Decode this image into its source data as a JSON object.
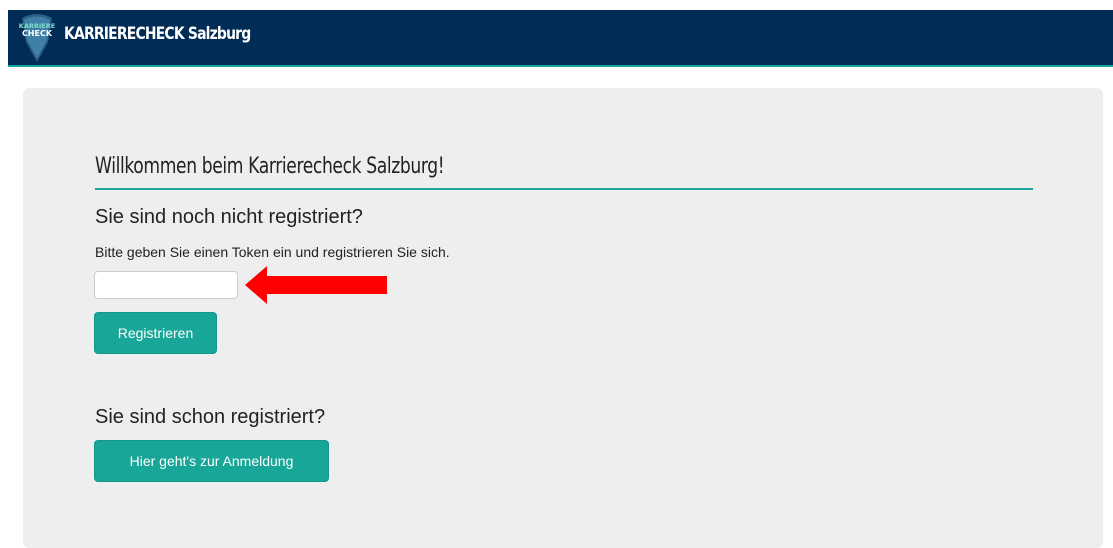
{
  "header": {
    "brand": "KARRIERECHECK Salzburg",
    "logo_text_line1": "KARRIERE",
    "logo_text_line2": "CHECK"
  },
  "main": {
    "welcome_title": "Willkommen beim Karrierecheck Salzburg!",
    "register_heading": "Sie sind noch nicht registriert?",
    "register_hint": "Bitte geben Sie einen Token ein und registrieren Sie sich.",
    "token_input_value": "",
    "register_button": "Registrieren",
    "login_heading": "Sie sind schon registriert?",
    "login_button": "Hier geht's zur Anmeldung"
  },
  "colors": {
    "navbar": "#002c56",
    "accent": "#17a697",
    "panel": "#eeeeee",
    "arrow": "#ff0000"
  }
}
